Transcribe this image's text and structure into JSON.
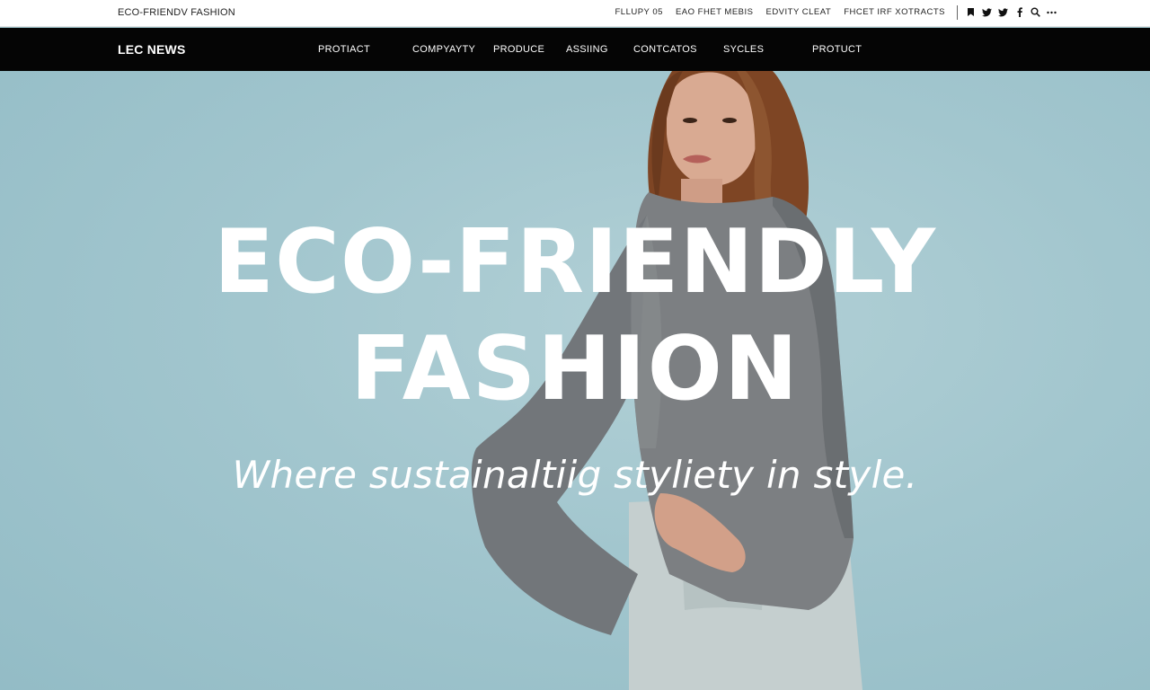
{
  "utility_bar": {
    "site_title": "ECO-FRIENDV FASHION",
    "links": [
      "FLLUPY 05",
      "EAO FHET MEBIS",
      "EDVITY CLEAT",
      "FHCET IRF XOTRACTS"
    ],
    "icons": [
      "bookmark-icon",
      "twitter-icon",
      "twitter-icon",
      "facebook-icon",
      "search-icon",
      "more-icon"
    ]
  },
  "main_nav": {
    "brand": "LEC NEWS",
    "items": [
      "PROTIACT",
      "COMPYAYTY",
      "PRODUCE",
      "ASSIING",
      "CONTCATOS",
      "SYCLES",
      "PROTUCT"
    ]
  },
  "hero": {
    "headline_line1": "ECO-FRIENDLY",
    "headline_line2": "FASHION",
    "tagline": "Where sustainaltiig styliety in style."
  },
  "colors": {
    "nav_background": "#050505",
    "hero_background": "#a2c6ce",
    "headline": "#ffffff",
    "sweater": "#7a7d80",
    "skirt": "#c5cfcf",
    "hair": "#8a4f2a"
  }
}
